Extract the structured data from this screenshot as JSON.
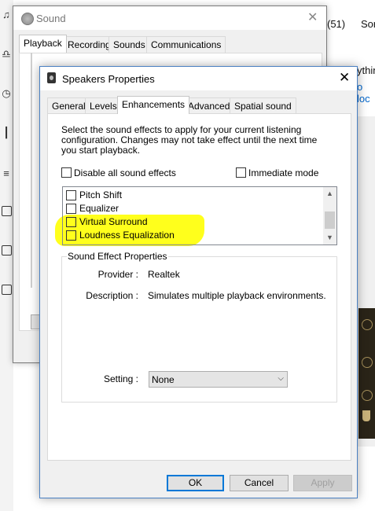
{
  "background": {
    "right_count": "(51)",
    "right_label": "Sor",
    "right_line1": "ythin",
    "right_line2": "o loc",
    "right_line2_color": "#0066cc"
  },
  "sound_window": {
    "title": "Sound",
    "close_glyph": "✕",
    "tabs": [
      "Playback",
      "Recording",
      "Sounds",
      "Communications"
    ],
    "active_tab": "Playback"
  },
  "speakers_window": {
    "title": "Speakers Properties",
    "close_glyph": "✕",
    "tabs": [
      "General",
      "Levels",
      "Enhancements",
      "Advanced",
      "Spatial sound"
    ],
    "active_tab": "Enhancements",
    "description": "Select the sound effects to apply for your current listening configuration. Changes may not take effect until the next time you start playback.",
    "disable_all_label": "Disable all sound effects",
    "immediate_mode_label": "Immediate mode",
    "effects": [
      {
        "label": "Pitch Shift",
        "checked": false
      },
      {
        "label": "Equalizer",
        "checked": false
      },
      {
        "label": "Virtual Surround",
        "checked": false
      },
      {
        "label": "Loudness Equalization",
        "checked": false
      }
    ],
    "properties_group_title": "Sound Effect Properties",
    "provider_label": "Provider :",
    "provider_value": "Realtek",
    "description_label": "Description :",
    "description_value": "Simulates multiple playback environments.",
    "setting_label": "Setting :",
    "setting_value": "None",
    "buttons": {
      "ok": "OK",
      "cancel": "Cancel",
      "apply": "Apply"
    },
    "highlight_color": "#ffff10",
    "accent_color": "#0078d7"
  }
}
